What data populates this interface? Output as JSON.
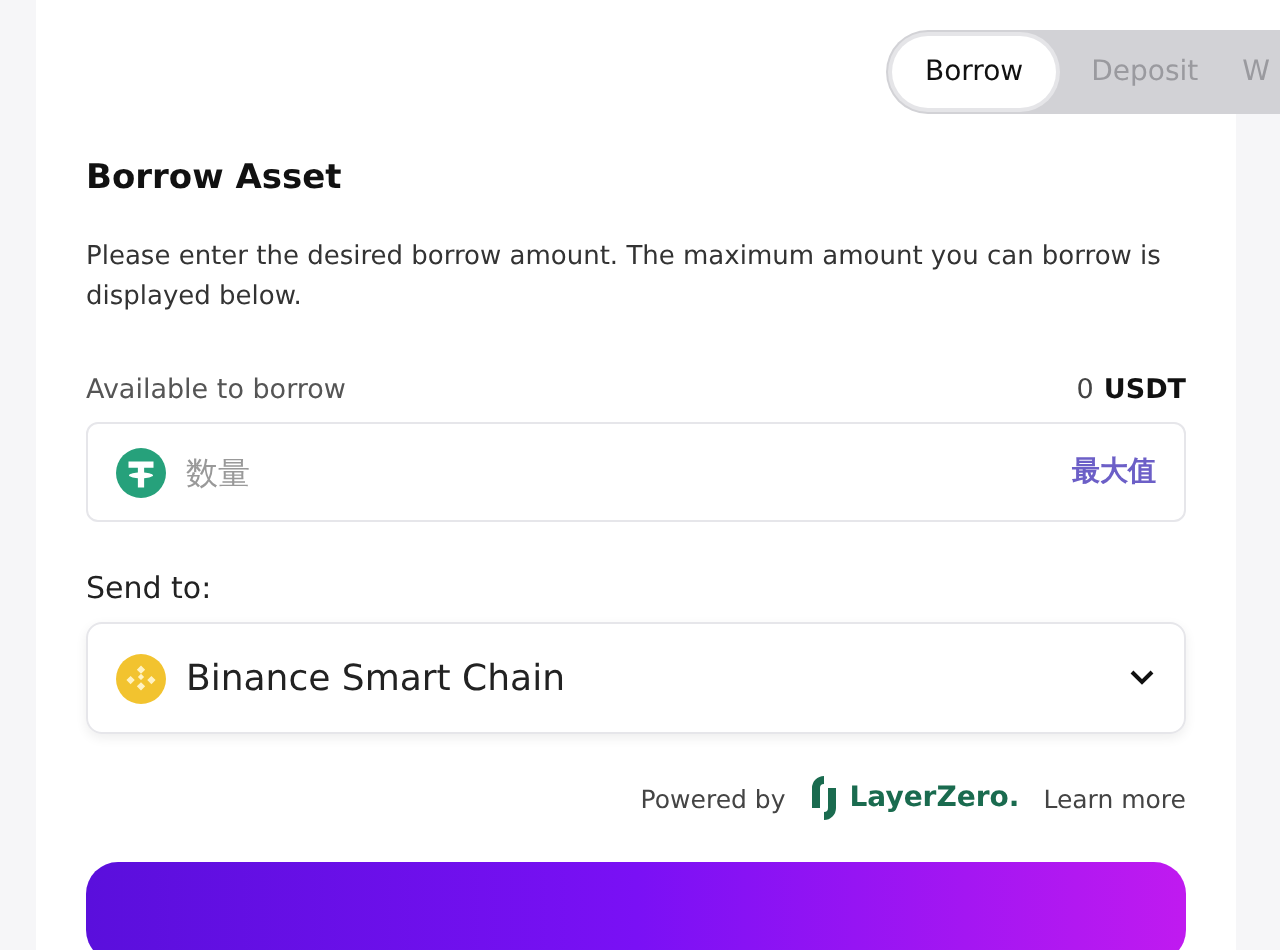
{
  "tabs": [
    {
      "label": "Borrow",
      "selected": true
    },
    {
      "label": "Deposit",
      "selected": false
    },
    {
      "label": "W",
      "selected": false
    }
  ],
  "title": "Borrow Asset",
  "description": "Please enter the desired borrow amount. The maximum amount you can borrow is displayed below.",
  "available": {
    "label": "Available to borrow",
    "amount": "0",
    "unit": "USDT"
  },
  "amount_field": {
    "placeholder": "数量",
    "max_label": "最大值"
  },
  "send_to": {
    "label": "Send to:",
    "value": "Binance Smart Chain"
  },
  "footer": {
    "powered_by": "Powered by",
    "brand": "LayerZero.",
    "link": "Learn more"
  }
}
